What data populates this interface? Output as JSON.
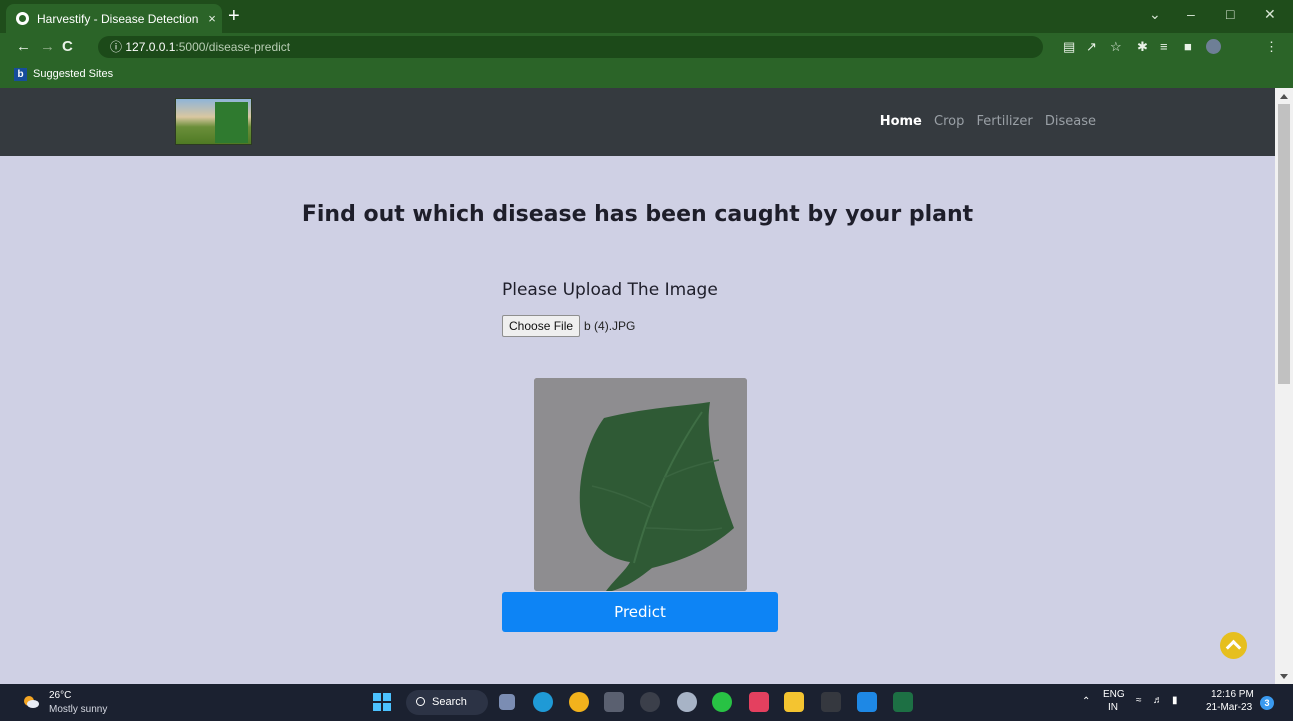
{
  "browser": {
    "tab_title": "Harvestify - Disease Detection",
    "tab_close": "×",
    "new_tab": "+",
    "url_host": "127.0.0.1",
    "url_path": ":5000/disease-predict",
    "bookmark_label": "Suggested Sites",
    "bookmark_icon_letter": "b"
  },
  "navbar": {
    "links": [
      "Home",
      "Crop",
      "Fertilizer",
      "Disease"
    ],
    "active_index": 0
  },
  "main": {
    "heading": "Find out which disease has been caught by your plant",
    "upload_label": "Please Upload The Image",
    "choose_file_label": "Choose File",
    "file_name": "b (4).JPG",
    "predict_label": "Predict"
  },
  "taskbar": {
    "temperature": "26°C",
    "weather": "Mostly sunny",
    "search_label": "Search",
    "language_top": "ENG",
    "language_bottom": "IN",
    "time": "12:16 PM",
    "date": "21-Mar-23",
    "notification_count": "3"
  },
  "colors": {
    "page_bg": "#cfd0e4",
    "navbar_bg": "#353a3f",
    "browser_green": "#2b6428",
    "predict_button": "#0d84f5",
    "scroll_top_button": "#e6bf1e"
  }
}
